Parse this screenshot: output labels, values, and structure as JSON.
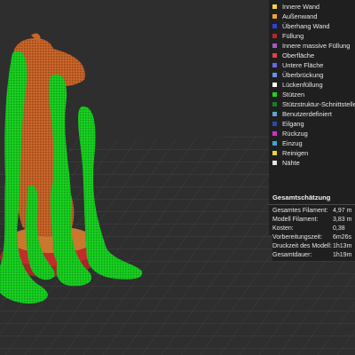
{
  "colors": {
    "background": "#2e2e2e",
    "panel": "#1f1f1f",
    "support_green": "#16d123",
    "model_orange": "#c45f22",
    "base_red": "#c42a2a"
  },
  "legend": {
    "items": [
      {
        "label": "Innere Wand",
        "color": "#f2d24a"
      },
      {
        "label": "Außenwand",
        "color": "#f2a12e"
      },
      {
        "label": "Überhang Wand",
        "color": "#2f40d8"
      },
      {
        "label": "Füllung",
        "color": "#b7272b"
      },
      {
        "label": "Innere massive Füllung",
        "color": "#a25dbd"
      },
      {
        "label": "Oberfläche",
        "color": "#e0453f"
      },
      {
        "label": "Untere Fläche",
        "color": "#6b66e0"
      },
      {
        "label": "Überbrückung",
        "color": "#6d8fe0"
      },
      {
        "label": "Lückenfüllung",
        "color": "#ffffff"
      },
      {
        "label": "Stützen",
        "color": "#1fd122"
      },
      {
        "label": "Stützstruktur-Schnittstelle",
        "color": "#1a7a2a"
      },
      {
        "label": "Benutzerdefiniert",
        "color": "#62a4c9"
      },
      {
        "label": "Eilgang",
        "color": "#2f49a8"
      },
      {
        "label": "Rückzug",
        "color": "#d22fc6"
      },
      {
        "label": "Einzug",
        "color": "#3aa7d0"
      },
      {
        "label": "Reinigen",
        "color": "#e8d33a"
      },
      {
        "label": "Nähte",
        "color": "#e4e4e4"
      }
    ]
  },
  "summary": {
    "title": "Gesamtschätzung",
    "rows": [
      {
        "label": "Gesamtes Filament:",
        "value": "4,97 m"
      },
      {
        "label": "Modell Filament:",
        "value": "3,83 m"
      },
      {
        "label": "Kosten:",
        "value": "0,38"
      },
      {
        "label": "Vorbereitungszeit:",
        "value": "6m26s"
      },
      {
        "label": "Druckzeit des Modell:",
        "value": "1h13m"
      },
      {
        "label": "Gesamtdauer:",
        "value": "1h19m"
      }
    ]
  }
}
